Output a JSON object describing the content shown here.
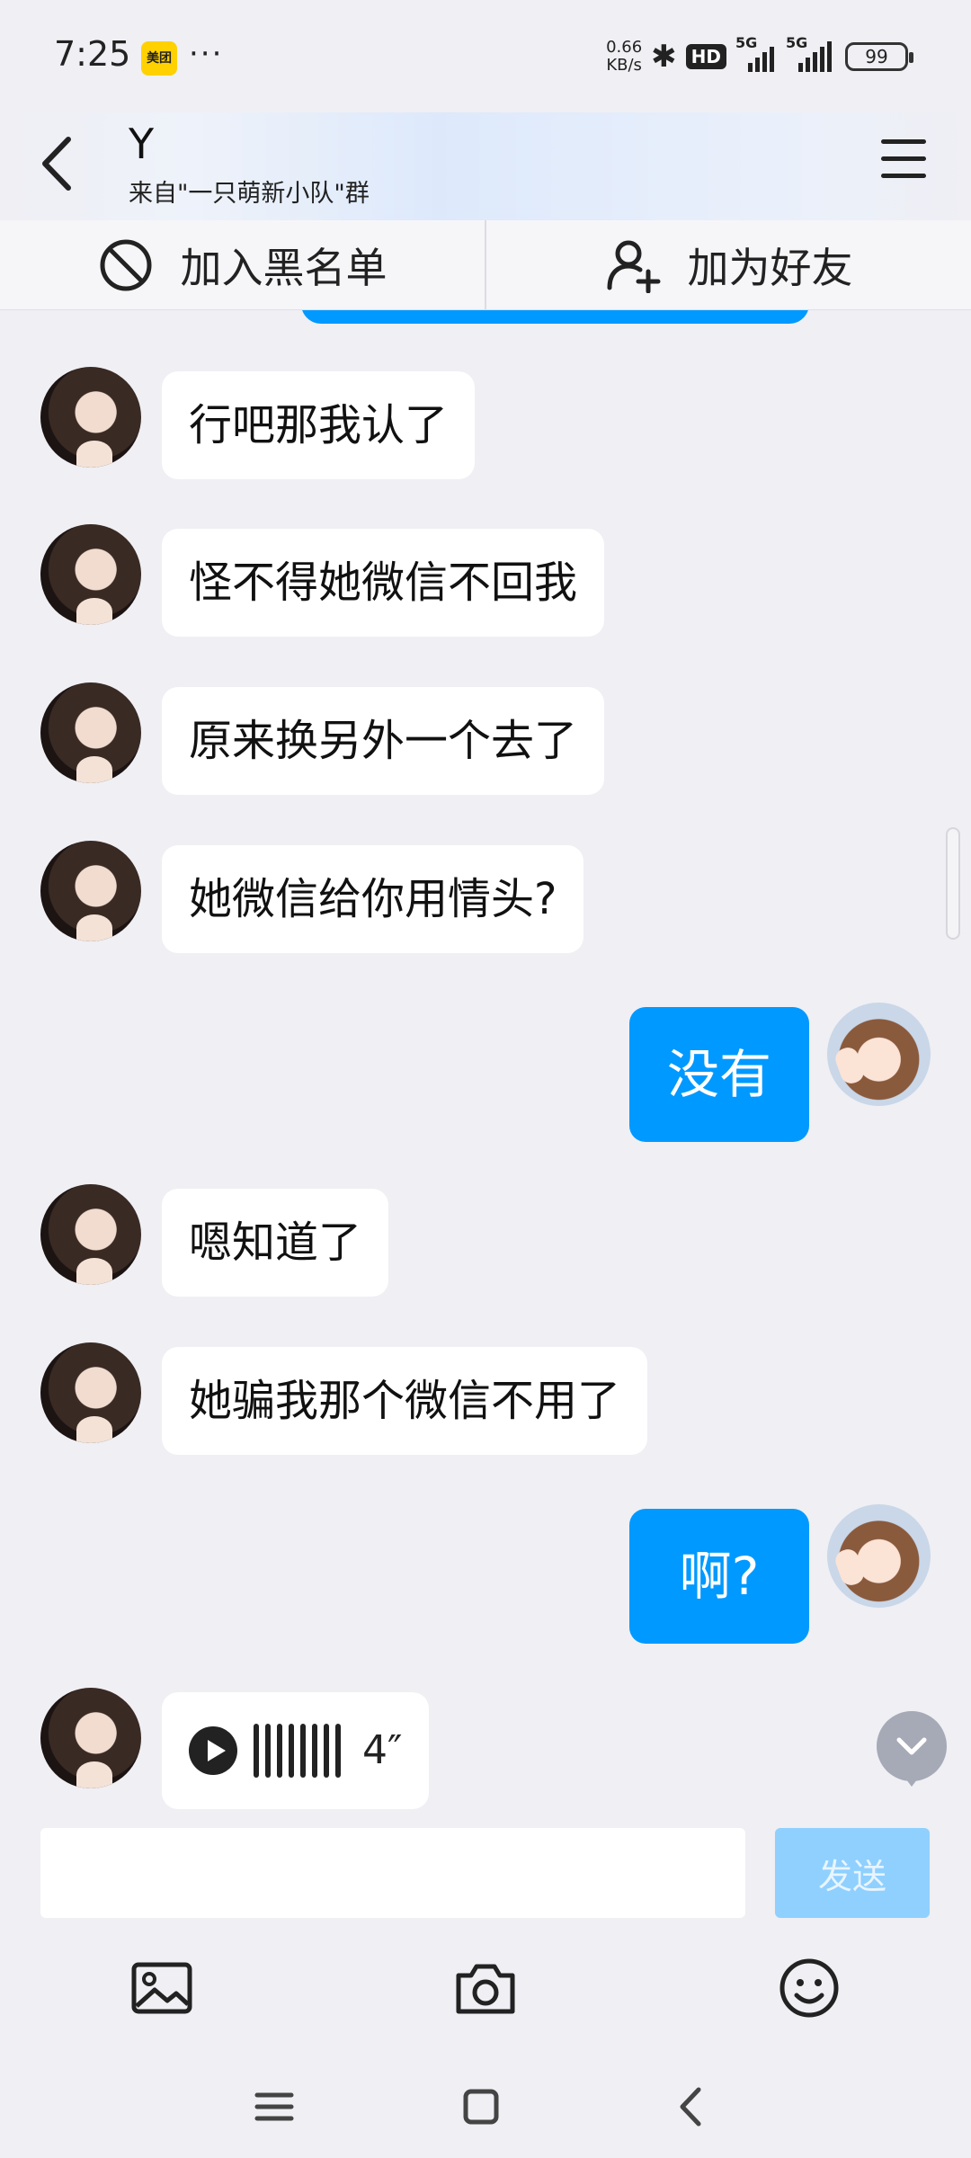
{
  "status_bar": {
    "time": "7:25",
    "app_badge": "美团",
    "more": "···",
    "speed_value": "0.66",
    "speed_unit": "KB/s",
    "hd_label": "HD",
    "network_1": "5G",
    "network_2": "5G",
    "battery": "99"
  },
  "header": {
    "title": "Y",
    "subtitle": "来自\"一只萌新小队\"群",
    "back_icon": "back-arrow-icon",
    "menu_icon": "menu-icon"
  },
  "actions": {
    "blacklist_label": "加入黑名单",
    "add_friend_label": "加为好友"
  },
  "messages": [
    {
      "side": "left",
      "type": "text",
      "text": "行吧那我认了"
    },
    {
      "side": "left",
      "type": "text",
      "text": "怪不得她微信不回我"
    },
    {
      "side": "left",
      "type": "text",
      "text": "原来换另外一个去了"
    },
    {
      "side": "left",
      "type": "text",
      "text": "她微信给你用情头?"
    },
    {
      "side": "right",
      "type": "text",
      "text": "没有"
    },
    {
      "side": "left",
      "type": "text",
      "text": "嗯知道了"
    },
    {
      "side": "left",
      "type": "text",
      "text": "她骗我那个微信不用了"
    },
    {
      "side": "right",
      "type": "text",
      "text": "啊?"
    },
    {
      "side": "left",
      "type": "voice",
      "duration": "4″"
    }
  ],
  "input": {
    "value": "",
    "send_label": "发送"
  },
  "toolbar": [
    "image-icon",
    "camera-icon",
    "emoji-icon"
  ],
  "colors": {
    "accent": "#0099ff",
    "send_disabled": "#8fd0ff",
    "background": "#efeff4"
  }
}
